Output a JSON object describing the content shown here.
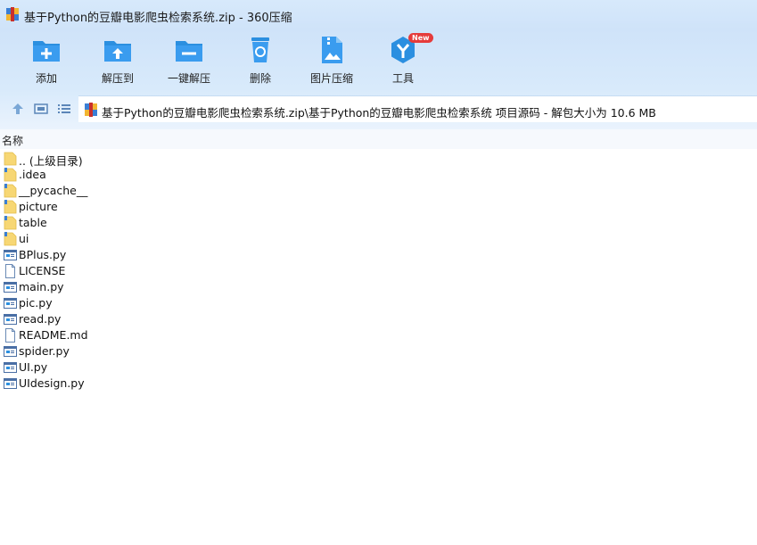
{
  "window": {
    "title": "基于Python的豆瓣电影爬虫检索系统.zip - 360压缩",
    "app_icon": "archive-icon"
  },
  "toolbar": {
    "buttons": [
      {
        "label": "添加",
        "icon": "add-folder-icon"
      },
      {
        "label": "解压到",
        "icon": "extract-to-icon"
      },
      {
        "label": "一键解压",
        "icon": "one-click-extract-icon"
      },
      {
        "label": "删除",
        "icon": "recycle-bin-icon"
      },
      {
        "label": "图片压缩",
        "icon": "image-compress-icon"
      },
      {
        "label": "工具",
        "icon": "tools-icon",
        "badge": "New"
      }
    ]
  },
  "address": {
    "path": "基于Python的豆瓣电影爬虫检索系统.zip\\基于Python的豆瓣电影爬虫检索系统 项目源码 - 解包大小为 10.6 MB"
  },
  "columns": {
    "name": "名称"
  },
  "files": [
    {
      "name": ".. (上级目录)",
      "type": "parent"
    },
    {
      "name": ".idea",
      "type": "folder"
    },
    {
      "name": "__pycache__",
      "type": "folder"
    },
    {
      "name": "picture",
      "type": "folder"
    },
    {
      "name": "table",
      "type": "folder"
    },
    {
      "name": "ui",
      "type": "folder"
    },
    {
      "name": "BPlus.py",
      "type": "py"
    },
    {
      "name": "LICENSE",
      "type": "file"
    },
    {
      "name": "main.py",
      "type": "py"
    },
    {
      "name": "pic.py",
      "type": "py"
    },
    {
      "name": "read.py",
      "type": "py"
    },
    {
      "name": "README.md",
      "type": "file"
    },
    {
      "name": "spider.py",
      "type": "py"
    },
    {
      "name": "UI.py",
      "type": "py"
    },
    {
      "name": "UIdesign.py",
      "type": "py"
    }
  ],
  "colors": {
    "accent": "#2b8fe0",
    "folder": "#f7d774",
    "badge": "#e53b3b"
  }
}
